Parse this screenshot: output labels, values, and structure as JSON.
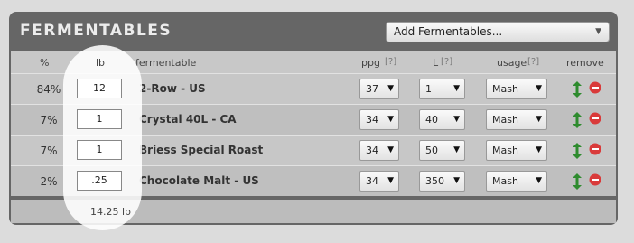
{
  "title": "FERMENTABLES",
  "add_select": {
    "value": "Add Fermentables..."
  },
  "headers": {
    "pct": "%",
    "lb": "lb",
    "fermentable": "fermentable",
    "ppg": "ppg",
    "ppg_help": "[?]",
    "l": "L",
    "l_help": "[?]",
    "usage": "usage",
    "usage_help": "[?]",
    "remove": "remove"
  },
  "rows": [
    {
      "pct": "84%",
      "lb": "12",
      "name": "2-Row - US",
      "ppg": "37",
      "l": "1",
      "usage": "Mash"
    },
    {
      "pct": "7%",
      "lb": "1",
      "name": "Crystal 40L - CA",
      "ppg": "34",
      "l": "40",
      "usage": "Mash"
    },
    {
      "pct": "7%",
      "lb": "1",
      "name": "Briess Special Roast",
      "ppg": "34",
      "l": "50",
      "usage": "Mash"
    },
    {
      "pct": "2%",
      "lb": ".25",
      "name": "Chocolate Malt - US",
      "ppg": "34",
      "l": "350",
      "usage": "Mash"
    }
  ],
  "total": "14.25 lb",
  "colors": {
    "panel": "#666666",
    "move": "#2e8b2e",
    "remove": "#d93a3a"
  },
  "icons": {
    "move": "up-down-arrow-icon",
    "remove": "remove-minus-icon",
    "dropdown": "triangle-down-icon"
  }
}
